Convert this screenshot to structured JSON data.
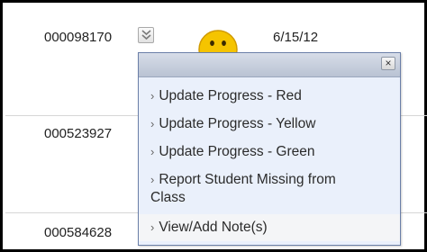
{
  "rows": [
    {
      "student_id": "000098170",
      "date": "6/15/12"
    },
    {
      "student_id": "000523927"
    },
    {
      "student_id": "000584628"
    }
  ],
  "menu": {
    "close_glyph": "×",
    "chevron": "›",
    "items": [
      {
        "label": "Update Progress - Red"
      },
      {
        "label": "Update Progress - Yellow"
      },
      {
        "label": "Update Progress - Green"
      },
      {
        "label_line1": "Report Student Missing from",
        "label_line2": "Class"
      },
      {
        "label": "View/Add Note(s)"
      }
    ]
  },
  "icons": {
    "row_menu": "double-chevron-down-icon",
    "status": "smiley-face-icon",
    "close": "close-icon"
  },
  "colors": {
    "menu_bg": "#eaf0fb",
    "menu_header": "#c4ccda",
    "menu_border": "#6b7fa8",
    "status_face": "#f5c400"
  }
}
